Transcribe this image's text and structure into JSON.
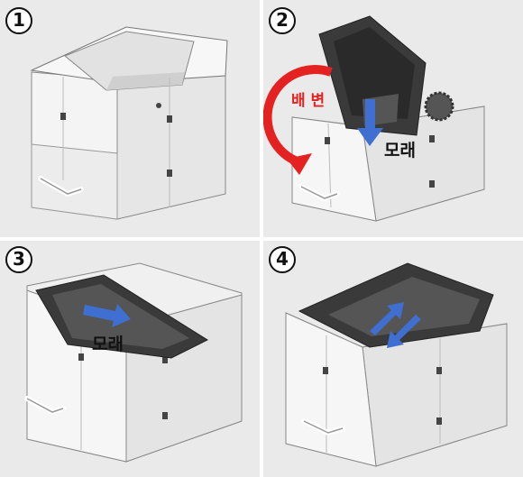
{
  "panels": [
    {
      "step": "1"
    },
    {
      "step": "2",
      "labels": {
        "rotate": "배 변",
        "sand": "모래"
      }
    },
    {
      "step": "3",
      "labels": {
        "sand": "모래"
      }
    },
    {
      "step": "4"
    }
  ],
  "colors": {
    "background": "#eaeaea",
    "box_light": "#f2f2f2",
    "box_side": "#dcdcdc",
    "box_dark": "#3a3a3a",
    "arrow_red": "#e52222",
    "arrow_blue": "#3e6fd1"
  },
  "icons": [
    "rotate-arrow-icon",
    "down-arrow-icon",
    "right-arrow-icon",
    "double-arrow-icon",
    "handle-icon"
  ]
}
